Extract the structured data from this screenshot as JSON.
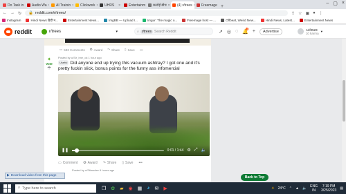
{
  "browser": {
    "tabs": [
      {
        "label": "Do Task in",
        "color": "#e44"
      },
      {
        "label": "Audio Wa",
        "color": "#c00"
      },
      {
        "label": "AI Trainin",
        "color": "#f90"
      },
      {
        "label": "Clickwork",
        "color": "#fb0"
      },
      {
        "label": "UHRS",
        "color": "#333"
      },
      {
        "label": "Entertainm",
        "color": "#c00"
      },
      {
        "label": "कारोई बीच",
        "color": "#777"
      },
      {
        "label": "(4) r/trees",
        "color": "#ff4500"
      },
      {
        "label": "Freemage",
        "color": "#c33"
      }
    ],
    "url": "reddit.com/r/trees/",
    "bookmarks": [
      "Instagram",
      "Hindi News हिंदी न...",
      "Entertainment News...",
      "ImgBB — Upload I...",
      "Imgur: The magic o...",
      "Freemage host — ...",
      "Offbeat, Weird New...",
      "Hindi News, Latest...",
      "Entertainment News"
    ]
  },
  "reddit_header": {
    "logo_text": "reddit",
    "subreddit": "r/trees",
    "search_pill": "r/trees",
    "search_placeholder": "Search Reddit",
    "advertise": "Advertise",
    "username": "Arif0523",
    "karma": "10 karma",
    "notif_count": "4"
  },
  "prev_post": {
    "comments": "593 Comments",
    "award": "Award",
    "share": "Share",
    "save": "Save",
    "more": "•••"
  },
  "post": {
    "vote_label": "Vote",
    "meta": "Posted by u/Sir_Ime_ok 1 hour ago",
    "flair": "Useful",
    "title": "Did anyone end up trying this vacuum ashtray? I got one and it's pretty fuckin slick, bonus points for the funny ass infomercial",
    "video_time": "0:01 / 1:44",
    "video_progress": 0.05,
    "comments": "Comment",
    "award": "Award",
    "share": "Share",
    "save": "Save",
    "more": "•••"
  },
  "next_post_meta": "Posted by u/Stimsdee 6 hours ago",
  "download_bar": "Download video from this page",
  "back_to_top": "Back to Top",
  "taskbar": {
    "search_placeholder": "Type here to search",
    "weather": "24°C",
    "lang": "ENG",
    "region": "IN",
    "time": "7:19 PM",
    "date": "3/25/2023"
  }
}
